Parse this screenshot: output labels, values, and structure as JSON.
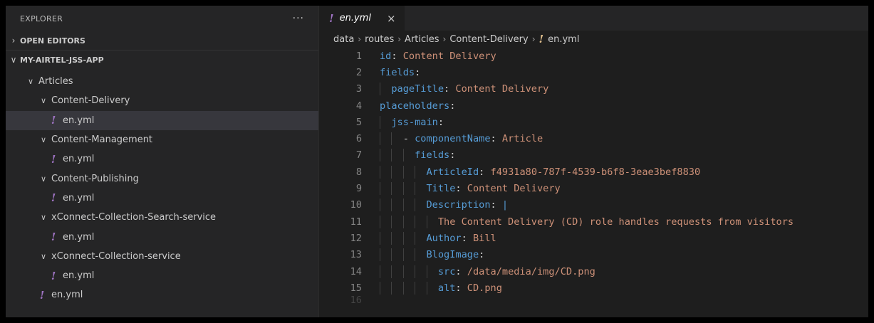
{
  "sidebar": {
    "title": "EXPLORER",
    "more": "···",
    "open_editors": "OPEN EDITORS",
    "project": "MY-AIRTEL-JSS-APP",
    "tree": [
      {
        "label": "Articles",
        "type": "folder",
        "level": 1
      },
      {
        "label": "Content-Delivery",
        "type": "folder",
        "level": 2
      },
      {
        "label": "en.yml",
        "type": "file",
        "level": 3,
        "selected": true
      },
      {
        "label": "Content-Management",
        "type": "folder",
        "level": 2
      },
      {
        "label": "en.yml",
        "type": "file",
        "level": 3
      },
      {
        "label": "Content-Publishing",
        "type": "folder",
        "level": 2
      },
      {
        "label": "en.yml",
        "type": "file",
        "level": 3
      },
      {
        "label": "xConnect-Collection-Search-service",
        "type": "folder",
        "level": 2
      },
      {
        "label": "en.yml",
        "type": "file",
        "level": 3
      },
      {
        "label": "xConnect-Collection-service",
        "type": "folder",
        "level": 2
      },
      {
        "label": "en.yml",
        "type": "file",
        "level": 3
      },
      {
        "label": "en.yml",
        "type": "file",
        "level": 2
      }
    ]
  },
  "tab": {
    "name": "en.yml",
    "close": "×"
  },
  "breadcrumb": [
    "data",
    "routes",
    "Articles",
    "Content-Delivery"
  ],
  "breadcrumb_file": "en.yml",
  "code": [
    {
      "n": "1",
      "indent": 0,
      "dash": false,
      "key": "id",
      "value": " Content Delivery"
    },
    {
      "n": "2",
      "indent": 0,
      "dash": false,
      "key": "fields",
      "value": ""
    },
    {
      "n": "3",
      "indent": 1,
      "dash": false,
      "key": "pageTitle",
      "value": " Content Delivery"
    },
    {
      "n": "4",
      "indent": 0,
      "dash": false,
      "key": "placeholders",
      "value": ""
    },
    {
      "n": "5",
      "indent": 1,
      "dash": false,
      "key": "jss-main",
      "value": ""
    },
    {
      "n": "6",
      "indent": 2,
      "dash": true,
      "key": "componentName",
      "value": " Article"
    },
    {
      "n": "7",
      "indent": 3,
      "dash": false,
      "key": "fields",
      "value": ""
    },
    {
      "n": "8",
      "indent": 4,
      "dash": false,
      "key": "ArticleId",
      "value": " f4931a80-787f-4539-b6f8-3eae3bef8830"
    },
    {
      "n": "9",
      "indent": 4,
      "dash": false,
      "key": "Title",
      "value": " Content Delivery"
    },
    {
      "n": "10",
      "indent": 4,
      "dash": false,
      "key": "Description",
      "value": " |"
    },
    {
      "n": "11",
      "indent": 5,
      "dash": false,
      "key": "",
      "value": "The Content Delivery (CD) role handles requests from visitors"
    },
    {
      "n": "12",
      "indent": 4,
      "dash": false,
      "key": "Author",
      "value": " Bill"
    },
    {
      "n": "13",
      "indent": 4,
      "dash": false,
      "key": "BlogImage",
      "value": ""
    },
    {
      "n": "14",
      "indent": 5,
      "dash": false,
      "key": "src",
      "value": " /data/media/img/CD.png"
    },
    {
      "n": "15",
      "indent": 5,
      "dash": false,
      "key": "alt",
      "value": " CD.png"
    },
    {
      "n": "16",
      "indent": 0,
      "dash": false,
      "key": "",
      "value": ""
    }
  ],
  "colors": {
    "key": "#569cd6",
    "string": "#ce9178",
    "yaml_icon": "#a074c4",
    "breadcrumb_icon": "#e2c08d"
  }
}
